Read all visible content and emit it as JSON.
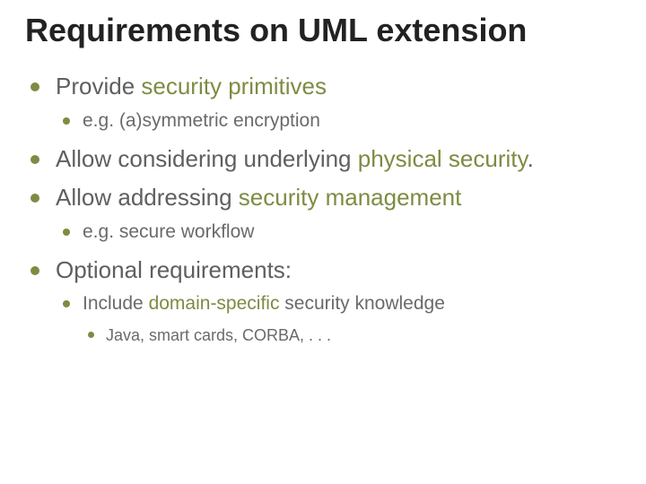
{
  "title": "Requirements on UML extension",
  "bullets": {
    "b1": {
      "pre": "Provide ",
      "accented": "security primitives",
      "sub1": "e.g. (a)symmetric encryption"
    },
    "b2": {
      "pre": "Allow considering underlying ",
      "accented": "physical security",
      "post": "."
    },
    "b3": {
      "pre": "Allow addressing ",
      "accented": "security management",
      "sub1": "e.g. secure workflow"
    },
    "b4": {
      "text": "Optional requirements:",
      "sub1_pre": "Include ",
      "sub1_accent": "domain-specific",
      "sub1_post": " security knowledge",
      "sub2": "Java, smart cards, CORBA, . . ."
    }
  }
}
